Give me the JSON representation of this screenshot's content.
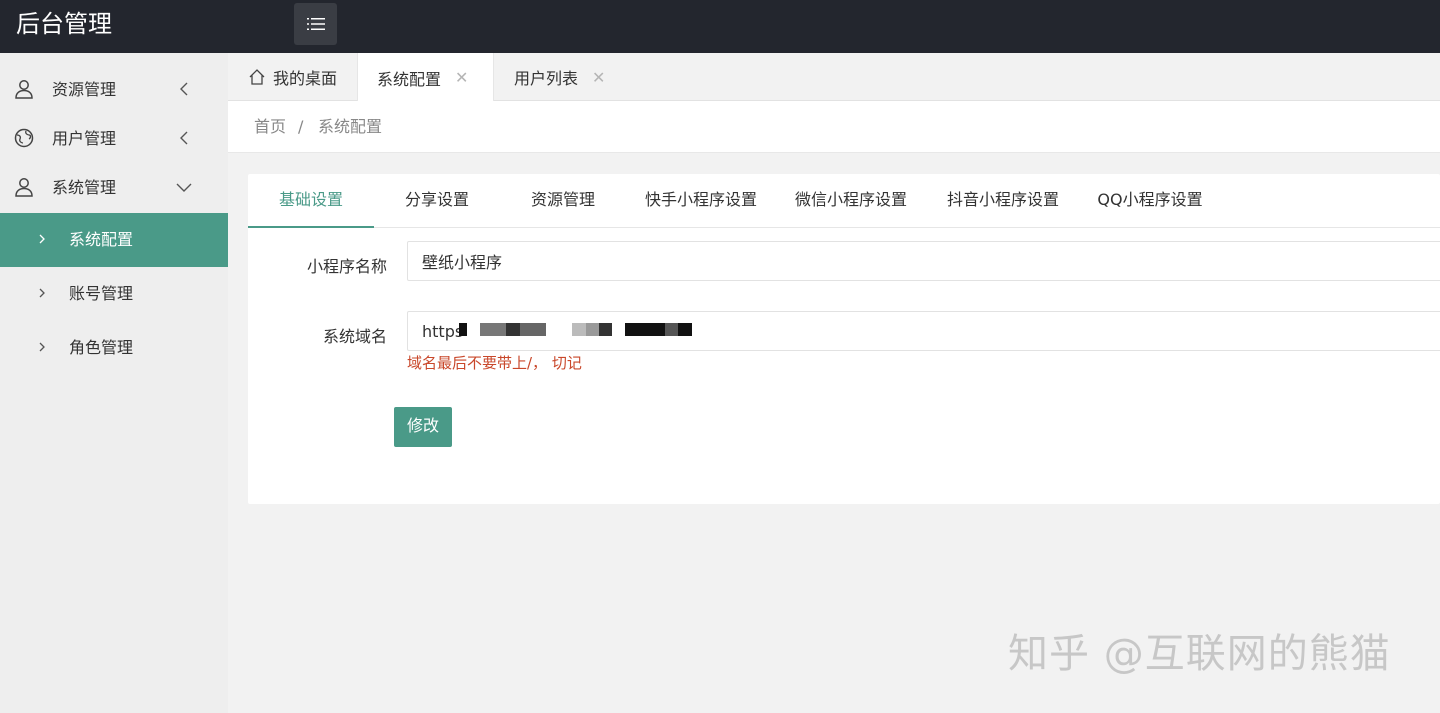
{
  "header": {
    "title": "后台管理"
  },
  "sidebar": {
    "items": [
      {
        "label": "资源管理",
        "icon": "user-icon",
        "expanded": false
      },
      {
        "label": "用户管理",
        "icon": "globe-icon",
        "expanded": false
      },
      {
        "label": "系统管理",
        "icon": "user-icon",
        "expanded": true
      }
    ],
    "sub_items": [
      {
        "label": "系统配置",
        "active": true
      },
      {
        "label": "账号管理",
        "active": false
      },
      {
        "label": "角色管理",
        "active": false
      }
    ]
  },
  "tabs": [
    {
      "label": "我的桌面",
      "icon": "home-icon",
      "closable": false
    },
    {
      "label": "系统配置",
      "closable": true,
      "active": true
    },
    {
      "label": "用户列表",
      "closable": true
    }
  ],
  "breadcrumb": {
    "home": "首页",
    "separator": "/",
    "current": "系统配置"
  },
  "settings_tabs": [
    "基础设置",
    "分享设置",
    "资源管理",
    "快手小程序设置",
    "微信小程序设置",
    "抖音小程序设置",
    "QQ小程序设置"
  ],
  "form": {
    "name_label": "小程序名称",
    "name_value": "壁纸小程序",
    "domain_label": "系统域名",
    "domain_value": "https",
    "domain_hint": "域名最后不要带上/， 切记",
    "submit_label": "修改"
  },
  "watermark": "知乎 @互联网的熊猫",
  "colors": {
    "header_bg": "#23262e",
    "accent": "#4a9a88",
    "hint": "#c9482b"
  }
}
